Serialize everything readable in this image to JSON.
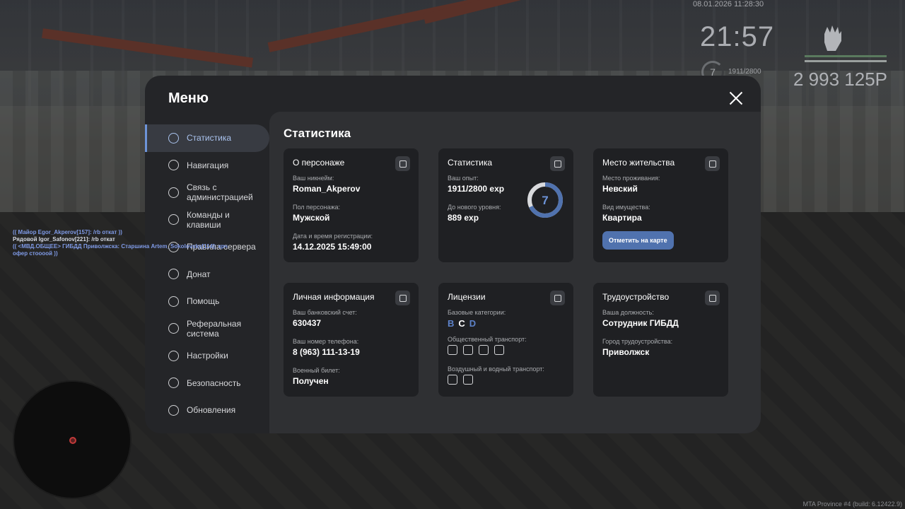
{
  "hud": {
    "timestamp": "08.01.2026 11:28:30",
    "clock": "21:57",
    "level": "7",
    "exp": "1911/2800",
    "money": "2 993 125P",
    "build": "MTA Province #4 (build: 6.12422.9)",
    "colors": {
      "health": "#5a7a5e",
      "armor": "#9aa09e"
    }
  },
  "chat": [
    "(( Майор Egor_Akperov[157]: /rb откат ))",
    "Рядовой Igor_Safonov[221]: /rb откат",
    "(( <МВД.ОБЩЕЕ> ГИБДД Приволжска: Старшина Artem_Sokolovsky[114]: крч",
    "офер стоооой ))"
  ],
  "menu": {
    "title": "Меню",
    "close_icon": "close-icon",
    "nav": [
      {
        "label": "Статистика",
        "icon": "pie-chart-icon",
        "active": true
      },
      {
        "label": "Навигация",
        "icon": "compass-icon"
      },
      {
        "label": "Связь с администрацией",
        "icon": "headset-icon"
      },
      {
        "label": "Команды и клавиши",
        "icon": "document-icon"
      },
      {
        "label": "Правила сервера",
        "icon": "scales-icon"
      },
      {
        "label": "Донат",
        "icon": "wallet-icon"
      },
      {
        "label": "Помощь",
        "icon": "heart-hands-icon"
      },
      {
        "label": "Реферальная система",
        "icon": "network-icon"
      },
      {
        "label": "Настройки",
        "icon": "gear-icon"
      },
      {
        "label": "Безопасность",
        "icon": "shield-icon"
      },
      {
        "label": "Обновления",
        "icon": "refresh-icon"
      }
    ]
  },
  "stats": {
    "title": "Статистика",
    "character": {
      "title": "О персонаже",
      "nickname_label": "Ваш никнейм:",
      "nickname": "Roman_Akperov",
      "gender_label": "Пол персонажа:",
      "gender": "Мужской",
      "reg_label": "Дата и время регистрации:",
      "reg": "14.12.2025 15:49:00"
    },
    "progress": {
      "title": "Статистика",
      "exp_label": "Ваш опыт:",
      "exp": "1911/2800 exp",
      "next_label": "До нового уровня:",
      "next": "889 exp",
      "level": "7",
      "level_fraction": 0.68
    },
    "residence": {
      "title": "Место жительства",
      "place_label": "Место проживания:",
      "place": "Невский",
      "property_label": "Вид имущества:",
      "property": "Квартира",
      "button": "Отметить на карте"
    },
    "personal": {
      "title": "Личная информация",
      "bank_label": "Ваш банковский счет:",
      "bank": "630437",
      "phone_label": "Ваш номер телефона:",
      "phone": "8 (963) 111-13-19",
      "military_label": "Военный билет:",
      "military": "Получен"
    },
    "licenses": {
      "title": "Лицензии",
      "base_label": "Базовые категории:",
      "categories": [
        {
          "l": "B",
          "c": "#5d82c9"
        },
        {
          "l": "C",
          "c": "#ffffff"
        },
        {
          "l": "D",
          "c": "#5d82c9"
        }
      ],
      "public_label": "Общественный транспорт:",
      "public_icons": [
        "bus-icon",
        "trolleybus-icon",
        "tram-icon",
        "train-icon"
      ],
      "air_label": "Воздушный и водный транспорт:",
      "air_icons": [
        "plane-icon",
        "boat-icon"
      ]
    },
    "job": {
      "title": "Трудоустройство",
      "position_label": "Ваша должность:",
      "position": "Сотрудник ГИБДД",
      "city_label": "Город трудоустройства:",
      "city": "Приволжск"
    }
  }
}
